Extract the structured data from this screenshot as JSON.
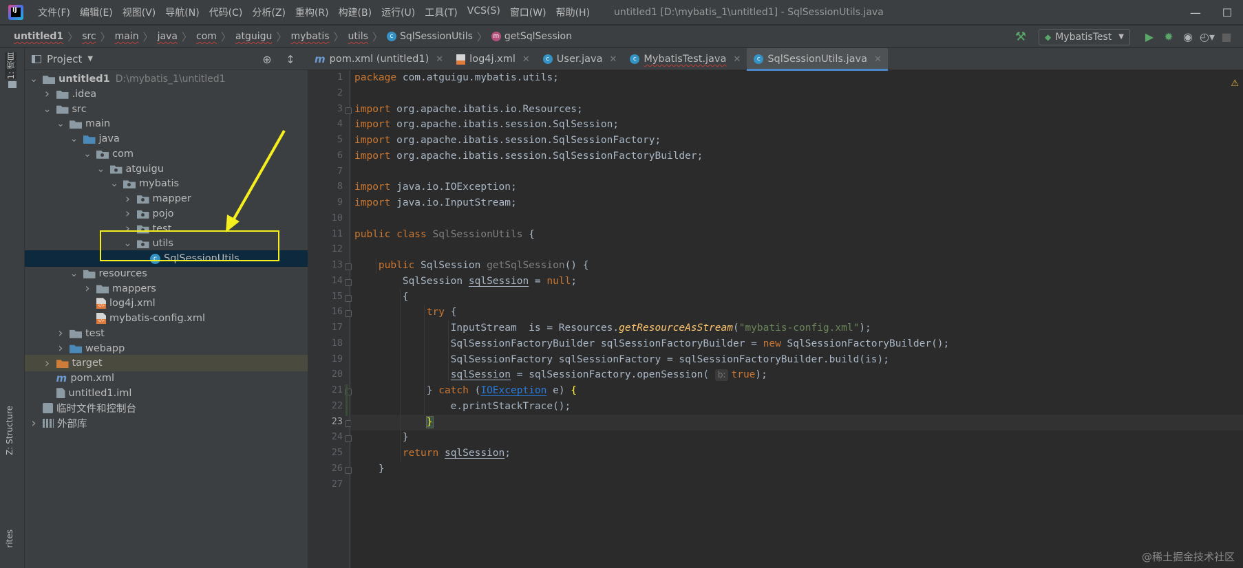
{
  "menubar": {
    "logo_text": "IJ",
    "items": [
      "文件(F)",
      "编辑(E)",
      "视图(V)",
      "导航(N)",
      "代码(C)",
      "分析(Z)",
      "重构(R)",
      "构建(B)",
      "运行(U)",
      "工具(T)",
      "VCS(S)",
      "窗口(W)",
      "帮助(H)"
    ],
    "window_title": "untitled1 [D:\\mybatis_1\\untitled1] - SqlSessionUtils.java",
    "minimize_glyph": "—",
    "maximize_glyph": "☐"
  },
  "breadcrumbs": [
    "untitled1",
    "src",
    "main",
    "java",
    "com",
    "atguigu",
    "mybatis",
    "utils",
    "SqlSessionUtils",
    "getSqlSession"
  ],
  "toolbar": {
    "run_config": "MybatisTest",
    "build_icon": "hammer-icon",
    "run_icon": "play-icon",
    "debug_icon": "bug-icon",
    "coverage_icon": "shield-run-icon",
    "profile_icon": "profile-icon",
    "stop_icon": "stop-icon"
  },
  "left_strip": {
    "project_tab": "1: 项目",
    "structure_tab": "Z: Structure",
    "favorites_tab": "rites"
  },
  "project_panel": {
    "title": "Project",
    "tree": [
      {
        "label": "untitled1",
        "hint": "D:\\mybatis_1\\untitled1",
        "depth": 0,
        "expanded": true,
        "icon": "module",
        "bold": true
      },
      {
        "label": ".idea",
        "depth": 1,
        "expanded": false,
        "icon": "folder"
      },
      {
        "label": "src",
        "depth": 1,
        "expanded": true,
        "icon": "folder"
      },
      {
        "label": "main",
        "depth": 2,
        "expanded": true,
        "icon": "folder"
      },
      {
        "label": "java",
        "depth": 3,
        "expanded": true,
        "icon": "folder-blue"
      },
      {
        "label": "com",
        "depth": 4,
        "expanded": true,
        "icon": "package"
      },
      {
        "label": "atguigu",
        "depth": 5,
        "expanded": true,
        "icon": "package"
      },
      {
        "label": "mybatis",
        "depth": 6,
        "expanded": true,
        "icon": "package"
      },
      {
        "label": "mapper",
        "depth": 7,
        "expanded": false,
        "icon": "package"
      },
      {
        "label": "pojo",
        "depth": 7,
        "expanded": false,
        "icon": "package"
      },
      {
        "label": "test",
        "depth": 7,
        "expanded": false,
        "icon": "package"
      },
      {
        "label": "utils",
        "depth": 7,
        "expanded": true,
        "icon": "package"
      },
      {
        "label": "SqlSessionUtils",
        "depth": 8,
        "expanded": null,
        "icon": "class-c",
        "selected": true
      },
      {
        "label": "resources",
        "depth": 3,
        "expanded": true,
        "icon": "resources"
      },
      {
        "label": "mappers",
        "depth": 4,
        "expanded": false,
        "icon": "folder"
      },
      {
        "label": "log4j.xml",
        "depth": 4,
        "expanded": null,
        "icon": "xml"
      },
      {
        "label": "mybatis-config.xml",
        "depth": 4,
        "expanded": null,
        "icon": "xml"
      },
      {
        "label": "test",
        "depth": 2,
        "expanded": false,
        "icon": "folder"
      },
      {
        "label": "webapp",
        "depth": 2,
        "expanded": false,
        "icon": "webapp"
      },
      {
        "label": "target",
        "depth": 1,
        "expanded": false,
        "icon": "folder-orange",
        "excluded": true
      },
      {
        "label": "pom.xml",
        "depth": 1,
        "expanded": null,
        "icon": "maven"
      },
      {
        "label": "untitled1.iml",
        "depth": 1,
        "expanded": null,
        "icon": "iml"
      },
      {
        "label": "临时文件和控制台",
        "depth": 0,
        "expanded": null,
        "icon": "scratch"
      },
      {
        "label": "外部库",
        "depth": 0,
        "expanded": false,
        "icon": "lib"
      }
    ]
  },
  "editor": {
    "tabs": [
      {
        "label": "pom.xml (untitled1)",
        "icon": "maven",
        "active": false,
        "error": false
      },
      {
        "label": "log4j.xml",
        "icon": "xml",
        "active": false,
        "error": false
      },
      {
        "label": "User.java",
        "icon": "c",
        "active": false,
        "error": false
      },
      {
        "label": "MybatisTest.java",
        "icon": "c",
        "active": false,
        "error": true
      },
      {
        "label": "SqlSessionUtils.java",
        "icon": "c",
        "active": true,
        "error": false
      }
    ],
    "current_line": 23,
    "line_count": 27
  },
  "watermark": "@稀土掘金技术社区"
}
